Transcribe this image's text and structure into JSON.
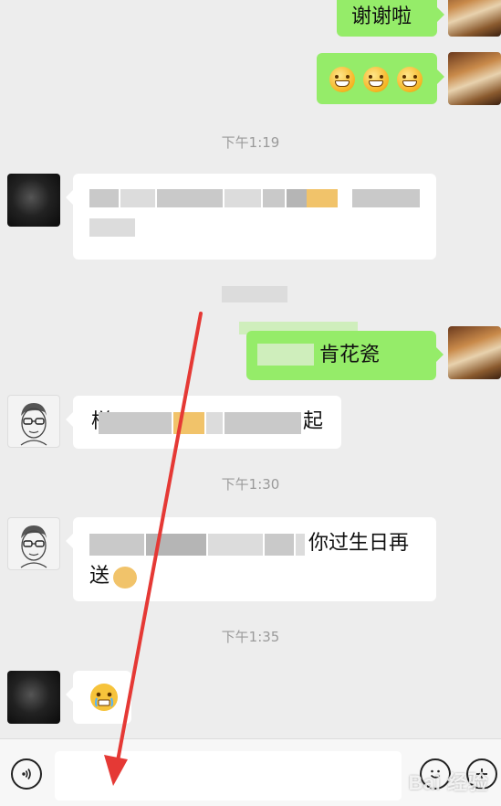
{
  "messages": {
    "m1_text": "谢谢啦",
    "m2_emoji": "grinning-face x3",
    "t1": "下午1:19",
    "m5_visible": "肯花瓷",
    "m6_visible_start": "样",
    "m6_visible_end": "起",
    "t2": "下午1:30",
    "m7_visible_line1": "你过生日再",
    "m7_visible_line2": "送",
    "t3": "下午1:35",
    "m8_emoji": "crying-face"
  },
  "bottom": {
    "voice_icon": "voice-icon",
    "emoji_icon": "emoji-icon",
    "plus_icon": "plus-icon"
  },
  "watermark": {
    "text": "Bai 经验"
  },
  "colors": {
    "background": "#ededed",
    "incoming_bubble": "#ffffff",
    "outgoing_bubble": "#95ec69",
    "timestamp": "#9a9a9a",
    "arrow": "#e53935"
  }
}
